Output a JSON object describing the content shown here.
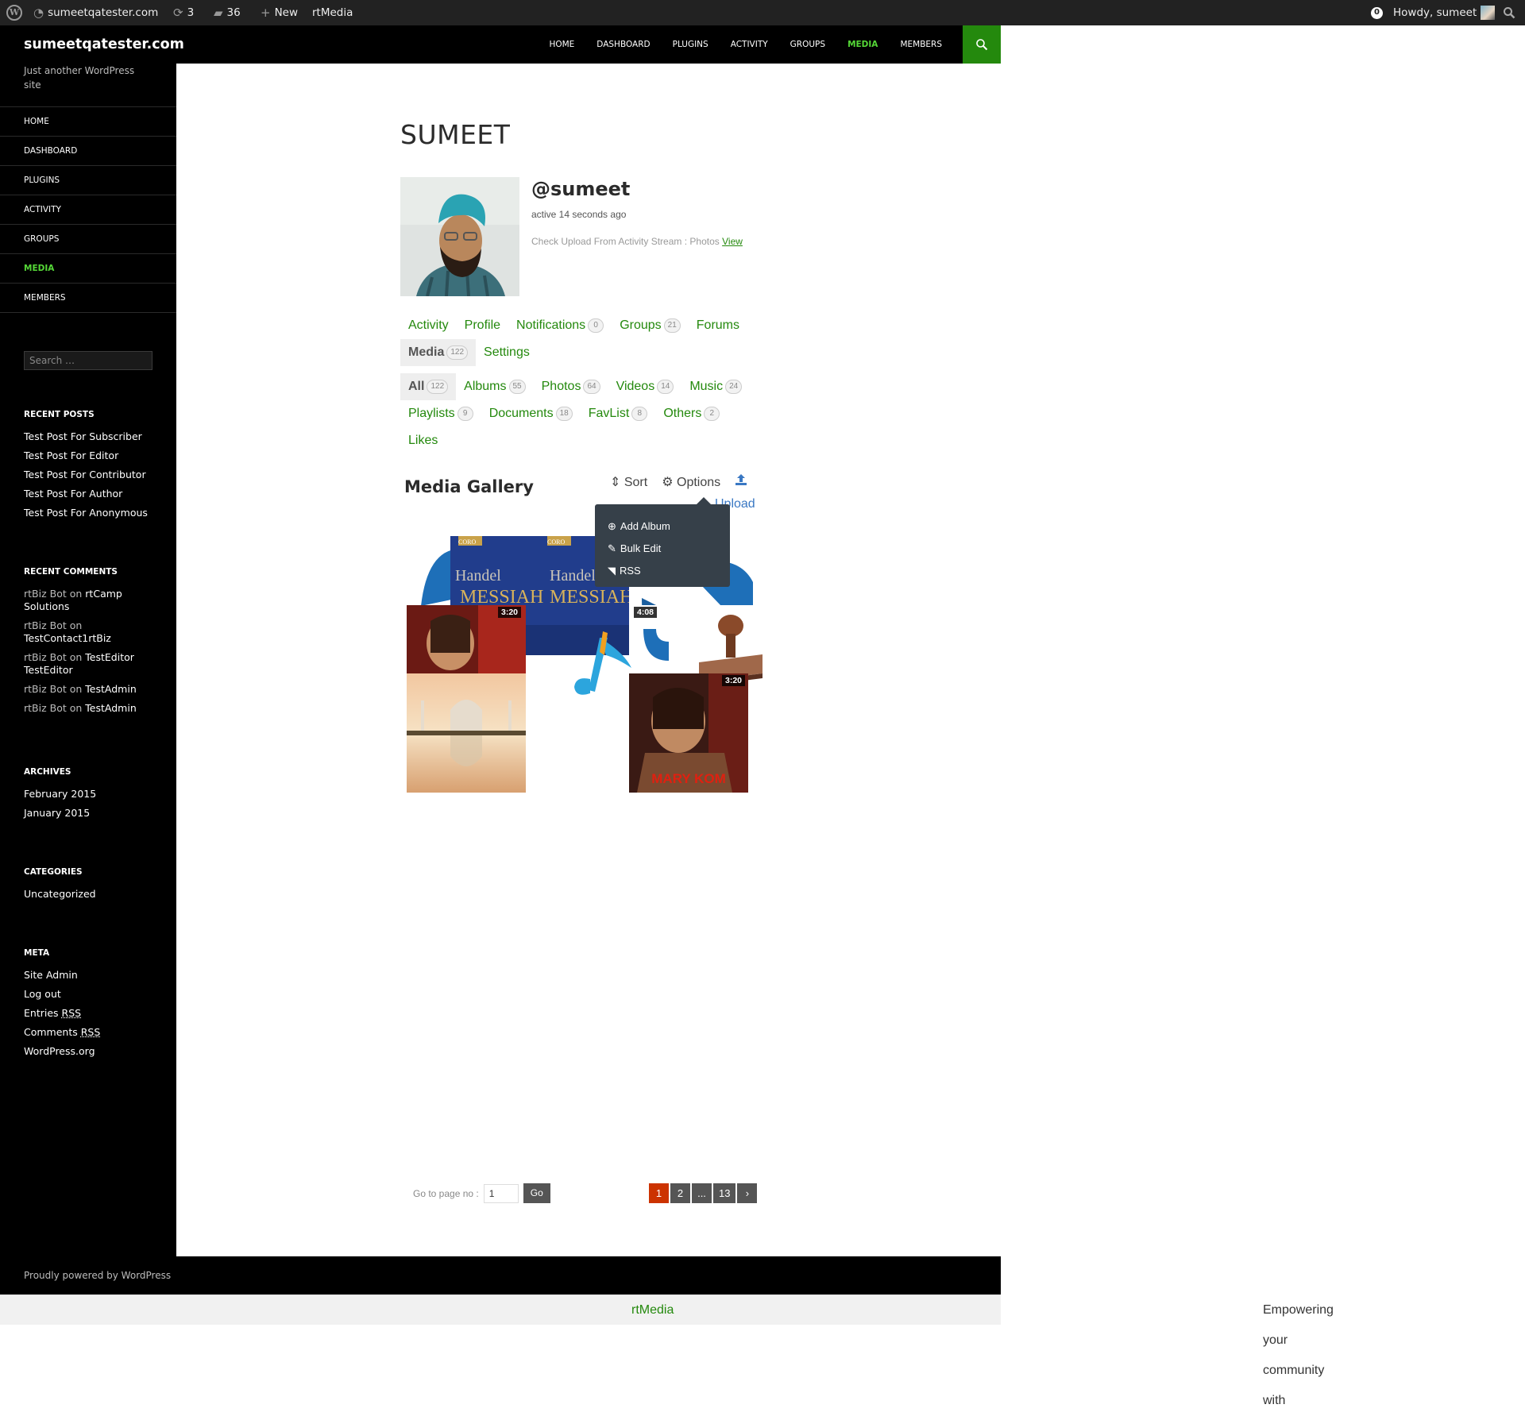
{
  "admin_bar": {
    "site": "sumeetqatester.com",
    "updates": "3",
    "comments": "36",
    "new": "New",
    "rtmedia": "rtMedia",
    "notifications": "0",
    "howdy": "Howdy, sumeet"
  },
  "site": {
    "title": "sumeetqatester.com",
    "tagline": "Just another WordPress site"
  },
  "primary_nav": [
    "HOME",
    "DASHBOARD",
    "PLUGINS",
    "ACTIVITY",
    "GROUPS",
    "MEDIA",
    "MEMBERS"
  ],
  "sidebar": {
    "nav": [
      "HOME",
      "DASHBOARD",
      "PLUGINS",
      "ACTIVITY",
      "GROUPS",
      "MEDIA",
      "MEMBERS"
    ],
    "search_placeholder": "Search …",
    "recent_posts_title": "RECENT POSTS",
    "recent_posts": [
      "Test Post For Subscriber",
      "Test Post For Editor",
      "Test Post For Contributor",
      "Test Post For Author",
      "Test Post For Anonymous"
    ],
    "recent_comments_title": "RECENT COMMENTS",
    "recent_comments": [
      {
        "author": "rtBiz Bot",
        "on": "on",
        "target": "rtCamp Solutions"
      },
      {
        "author": "rtBiz Bot",
        "on": "on",
        "target": "TestContact1rtBiz"
      },
      {
        "author": "rtBiz Bot",
        "on": "on",
        "target": "TestEditor TestEditor"
      },
      {
        "author": "rtBiz Bot",
        "on": "on",
        "target": "TestAdmin"
      },
      {
        "author": "rtBiz Bot",
        "on": "on",
        "target": "TestAdmin"
      }
    ],
    "archives_title": "ARCHIVES",
    "archives": [
      "February 2015",
      "January 2015"
    ],
    "categories_title": "CATEGORIES",
    "categories": [
      "Uncategorized"
    ],
    "meta_title": "META",
    "meta": {
      "site_admin": "Site Admin",
      "log_out": "Log out",
      "entries": "Entries",
      "comments": "Comments",
      "rss": "RSS",
      "wordpress_org": "WordPress.org"
    }
  },
  "profile": {
    "page_title": "SUMEET",
    "handle": "@sumeet",
    "active": "active 14 seconds ago",
    "latest_update": "Check Upload From Activity Stream : Photos",
    "view_link": "View"
  },
  "member_tabs": [
    {
      "label": "Activity"
    },
    {
      "label": "Profile"
    },
    {
      "label": "Notifications",
      "count": "0"
    },
    {
      "label": "Groups",
      "count": "21"
    },
    {
      "label": "Forums"
    },
    {
      "label": "Media",
      "count": "122",
      "active": true
    },
    {
      "label": "Settings"
    }
  ],
  "media_tabs": [
    {
      "label": "All",
      "count": "122",
      "active": true
    },
    {
      "label": "Albums",
      "count": "55"
    },
    {
      "label": "Photos",
      "count": "64"
    },
    {
      "label": "Videos",
      "count": "14"
    },
    {
      "label": "Music",
      "count": "24"
    },
    {
      "label": "Playlists",
      "count": "9"
    },
    {
      "label": "Documents",
      "count": "18"
    },
    {
      "label": "FavList",
      "count": "8"
    },
    {
      "label": "Others",
      "count": "2"
    },
    {
      "label": "Likes"
    }
  ],
  "gallery": {
    "title": "Media Gallery",
    "sort": "Sort",
    "options": "Options",
    "upload": "Upload",
    "options_menu": [
      "Add Album",
      "Bulk Edit",
      "RSS"
    ],
    "durations": [
      "3:20",
      "4:08",
      "3:20"
    ],
    "album_text": [
      "Handel",
      "MESSIAH",
      "Handel",
      "MESSIAH",
      "CORO"
    ],
    "movie_title": "MARY KOM"
  },
  "pagination": {
    "go_label": "Go to page no :",
    "page_value": "1",
    "go_button": "Go",
    "pages": [
      "1",
      "2",
      "...",
      "13",
      "›"
    ]
  },
  "footer": {
    "powered": "Proudly powered by WordPress",
    "rtmedia_text": "Empowering your community with",
    "rtmedia_link": "rtMedia"
  },
  "colors": {
    "accent_green": "#24890d",
    "current_green": "#55d737",
    "pager_current": "#cc3300",
    "dropdown_bg": "#364049"
  }
}
